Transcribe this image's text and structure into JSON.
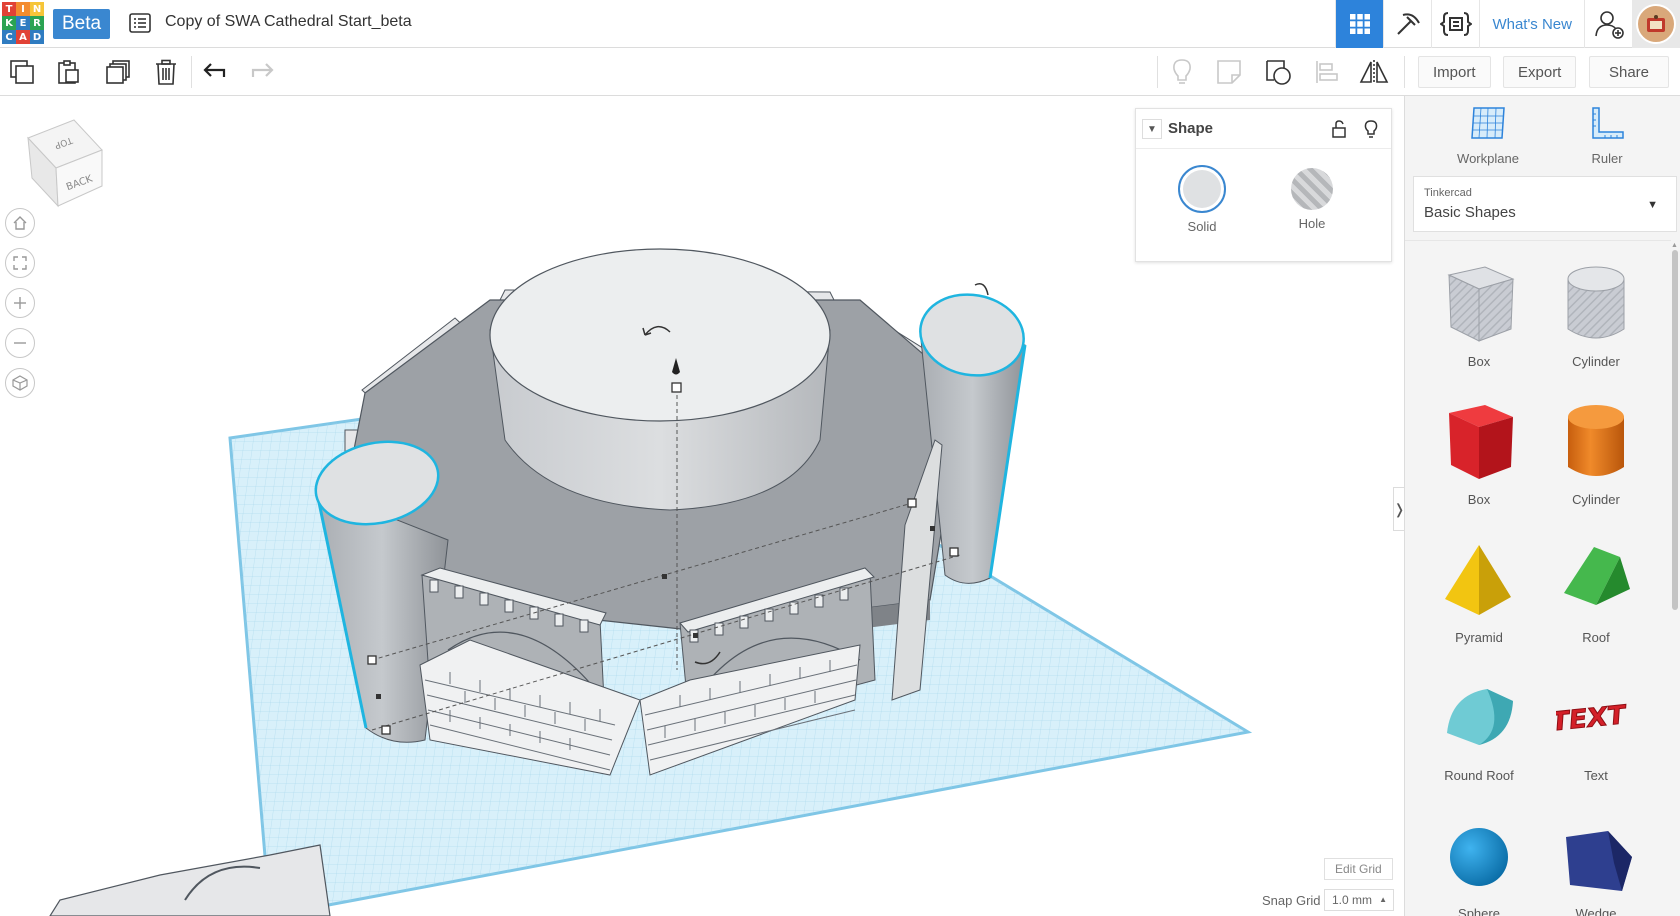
{
  "app": {
    "logo_letters": [
      "T",
      "I",
      "N",
      "K",
      "E",
      "R",
      "C",
      "A",
      "D"
    ],
    "logo_colors": [
      "#e14236",
      "#f48c2f",
      "#f6c538",
      "#2aa352",
      "#2f7cc1",
      "#2aa352",
      "#2f7cc1",
      "#e14236",
      "#2f7cc1"
    ],
    "beta_label": "Beta",
    "design_title": "Copy of SWA Cathedral Start_beta",
    "whats_new": "What's New"
  },
  "topbar_icons": [
    "grid-view-icon",
    "pickaxe-icon",
    "codeblocks-icon",
    "add-user-icon",
    "profile-avatar"
  ],
  "toolbar": {
    "left_icons": [
      "copy-icon",
      "paste-icon",
      "duplicate-icon",
      "trash-icon",
      "undo-icon",
      "redo-icon"
    ],
    "right_icons": [
      "light-bulb-icon",
      "note-icon",
      "shape-note-icon",
      "align-icon",
      "mirror-icon"
    ],
    "import_label": "Import",
    "export_label": "Export",
    "share_label": "Share"
  },
  "viewcube": {
    "top_label": "TOP",
    "back_label": "BACK"
  },
  "nav_controls": [
    "home-icon",
    "fit-icon",
    "zoom-in-icon",
    "zoom-out-icon",
    "ortho-icon"
  ],
  "shape_panel": {
    "title": "Shape",
    "solid_label": "Solid",
    "hole_label": "Hole",
    "selected": "Solid"
  },
  "grid": {
    "edit_grid_label": "Edit Grid",
    "snap_grid_label": "Snap Grid",
    "snap_grid_value": "1.0 mm"
  },
  "right_panel": {
    "workplane_label": "Workplane",
    "ruler_label": "Ruler",
    "library_small": "Tinkercad",
    "library_name": "Basic Shapes",
    "shapes": [
      {
        "label": "Box",
        "color": "#c9ccd3"
      },
      {
        "label": "Cylinder",
        "color": "#c9ccd3"
      },
      {
        "label": "Box",
        "color": "#d8232a"
      },
      {
        "label": "Cylinder",
        "color": "#e57316"
      },
      {
        "label": "Pyramid",
        "color": "#f2c511"
      },
      {
        "label": "Roof",
        "color": "#32a33b"
      },
      {
        "label": "Round Roof",
        "color": "#5bc0ca"
      },
      {
        "label": "Text",
        "color": "#d42029"
      },
      {
        "label": "Sphere",
        "color": "#1390d4"
      },
      {
        "label": "Wedge",
        "color": "#27367a"
      }
    ]
  },
  "colors": {
    "accent": "#2d83db",
    "grid": "#b9e2f3",
    "model": "#9a9ea3",
    "selection": "#1fb5e0"
  }
}
